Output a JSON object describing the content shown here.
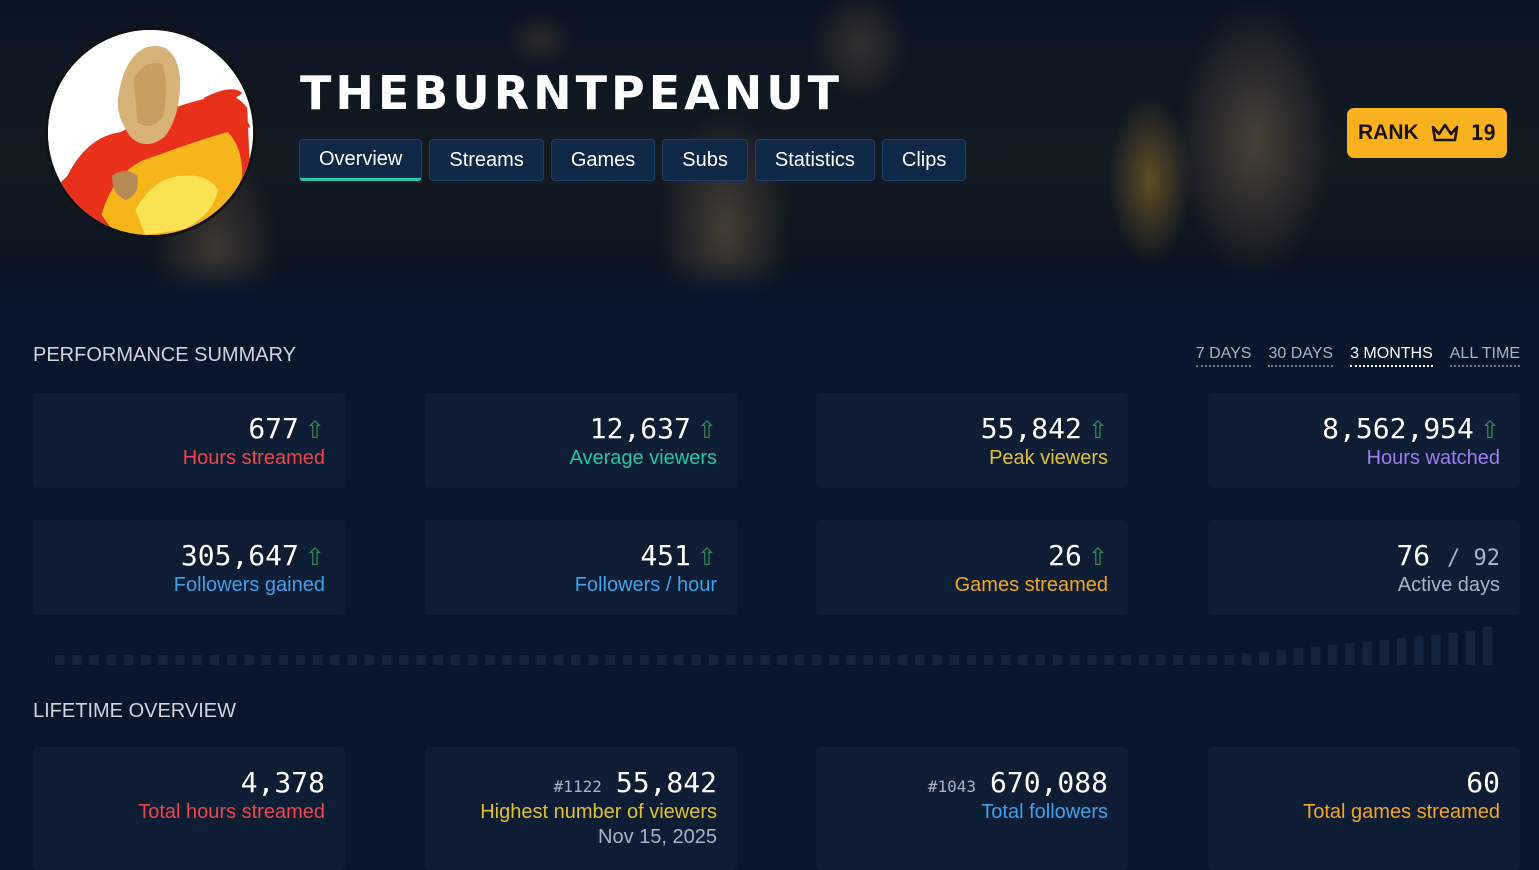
{
  "channel": {
    "name": "THEBURNTPEANUT"
  },
  "tabs": [
    "Overview",
    "Streams",
    "Games",
    "Subs",
    "Statistics",
    "Clips"
  ],
  "rank": {
    "label": "RANK",
    "value": "19"
  },
  "performance": {
    "title": "PERFORMANCE SUMMARY",
    "ranges": [
      "7 DAYS",
      "30 DAYS",
      "3 MONTHS",
      "ALL TIME"
    ],
    "active_range": "3 MONTHS",
    "cards": [
      {
        "value": "677",
        "label": "Hours streamed",
        "color": "#f0454a"
      },
      {
        "value": "12,637",
        "label": "Average viewers",
        "color": "#1fc7a8"
      },
      {
        "value": "55,842",
        "label": "Peak viewers",
        "color": "#e3c12e"
      },
      {
        "value": "8,562,954",
        "label": "Hours watched",
        "color": "#9f7df5"
      },
      {
        "value": "305,647",
        "label": "Followers gained",
        "color": "#3ea2ee"
      },
      {
        "value": "451",
        "label": "Followers / hour",
        "color": "#3ea2ee"
      },
      {
        "value": "26",
        "label": "Games streamed",
        "color": "#f5a524"
      },
      {
        "value": "76",
        "of": "/ 92",
        "label": "Active days",
        "color": "#aab4c2"
      }
    ]
  },
  "lifetime": {
    "title": "LIFETIME OVERVIEW",
    "cards": [
      {
        "value": "4,378",
        "label": "Total hours streamed",
        "color": "#f0454a"
      },
      {
        "rank": "#1122",
        "value": "55,842",
        "label": "Highest number of viewers",
        "sub": "Nov 15, 2025",
        "color": "#e3c12e"
      },
      {
        "rank": "#1043",
        "value": "670,088",
        "label": "Total followers",
        "color": "#3ea2ee"
      },
      {
        "value": "60",
        "label": "Total games streamed",
        "color": "#f5a524"
      }
    ]
  },
  "icons": {
    "trend": "arrow-up-icon",
    "rank": "crown-icon"
  }
}
